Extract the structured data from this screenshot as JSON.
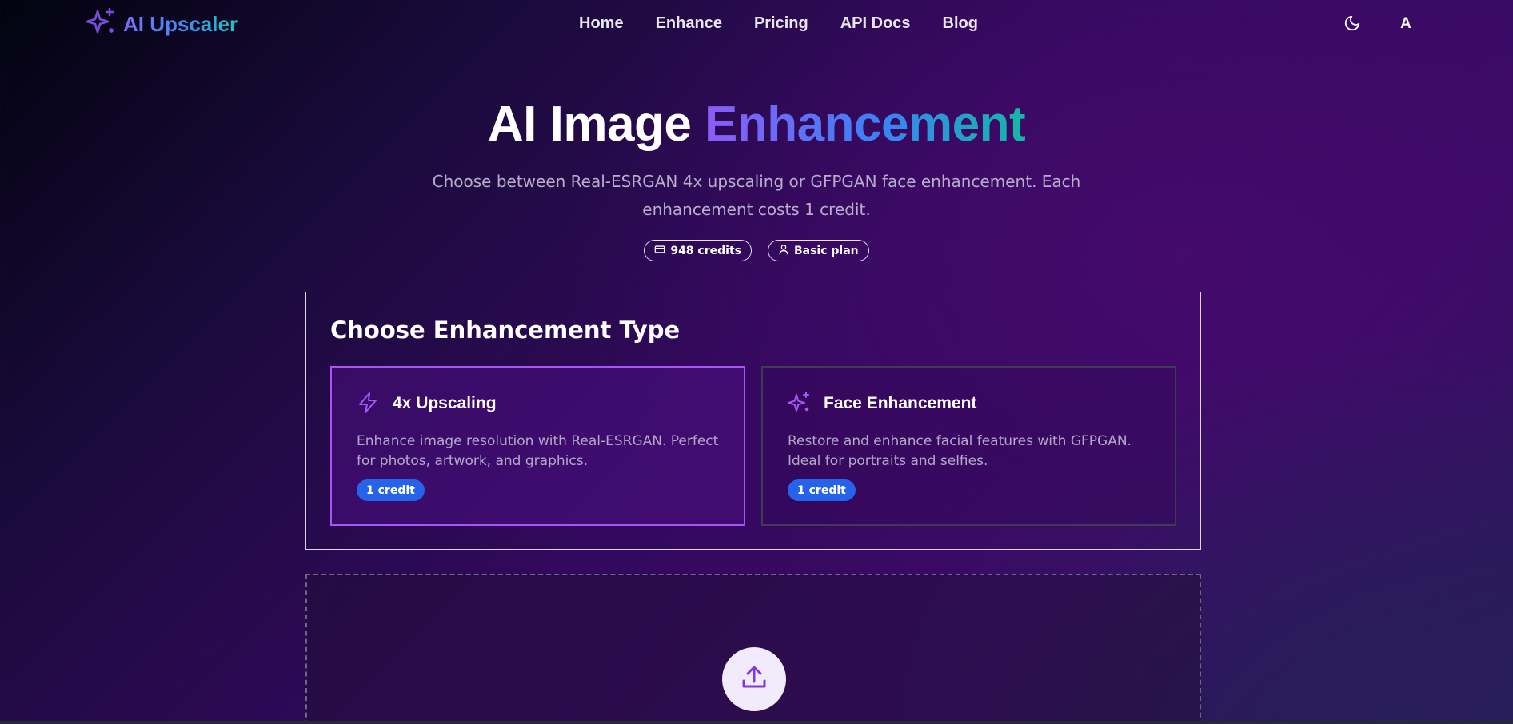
{
  "header": {
    "logo_text": "AI Upscaler",
    "logo_icon": "sparkles-icon",
    "nav": [
      {
        "label": "Home"
      },
      {
        "label": "Enhance"
      },
      {
        "label": "Pricing"
      },
      {
        "label": "API Docs"
      },
      {
        "label": "Blog"
      }
    ],
    "theme_icon": "moon-icon",
    "avatar_initial": "A"
  },
  "hero": {
    "title_plain": "AI Image ",
    "title_accent": "Enhancement",
    "subtitle": "Choose between Real-ESRGAN 4x upscaling or GFPGAN face enhancement. Each enhancement costs 1 credit.",
    "badges": [
      {
        "icon": "credit-card-icon",
        "label": "948 credits"
      },
      {
        "icon": "user-icon",
        "label": "Basic plan"
      }
    ]
  },
  "enhancement_type": {
    "title": "Choose Enhancement Type",
    "options": [
      {
        "icon": "zap-icon",
        "title": "4x Upscaling",
        "description": "Enhance image resolution with Real-ESRGAN. Perfect for photos, artwork, and graphics.",
        "credit_label": "1 credit",
        "selected": true
      },
      {
        "icon": "sparkles-icon",
        "title": "Face Enhancement",
        "description": "Restore and enhance facial features with GFPGAN. Ideal for portraits and selfies.",
        "credit_label": "1 credit",
        "selected": false
      }
    ]
  },
  "upload": {
    "icon": "upload-icon"
  },
  "colors": {
    "accent_purple": "#a855f7",
    "pill_blue": "#2563eb",
    "gradient_start": "#8b5cf6",
    "gradient_mid": "#3b82f6",
    "gradient_end": "#14b8a6"
  }
}
